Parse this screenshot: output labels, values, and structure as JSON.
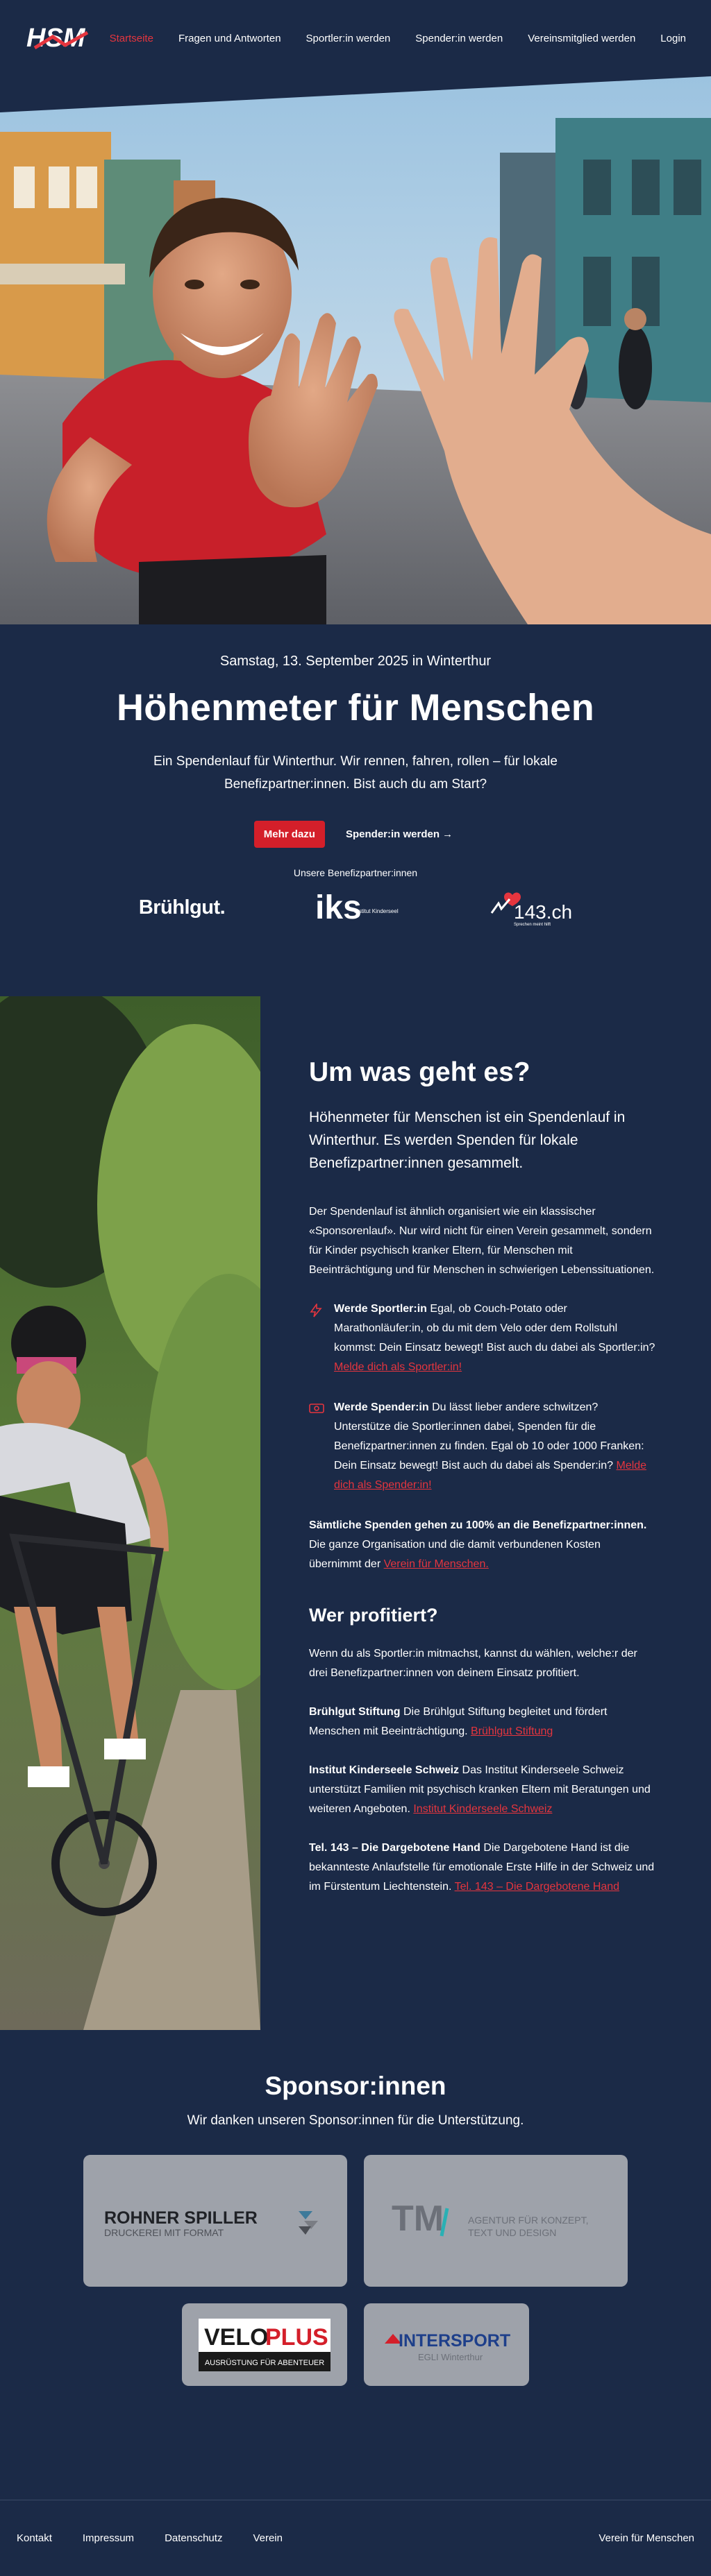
{
  "nav": {
    "logo_text": "HSM",
    "links": [
      {
        "label": "Startseite",
        "active": true
      },
      {
        "label": "Fragen und Antworten"
      },
      {
        "label": "Sportler:in werden"
      },
      {
        "label": "Spender:in werden"
      },
      {
        "label": "Vereinsmitglied werden"
      },
      {
        "label": "Login"
      }
    ]
  },
  "event": {
    "date": "Samstag, 13. September 2025 in Winterthur",
    "title": "Höhenmeter für Menschen",
    "desc": "Ein Spendenlauf für Winterthur. Wir rennen, fahren, rollen – für lokale Benefizpartner:innen. Bist auch du am Start?",
    "btn_more": "Mehr dazu",
    "btn_donor": "Spender:in werden →",
    "partners_title": "Unsere Benefizpartner:innen",
    "partners": [
      "Brühlgut.",
      "iks",
      "Institut Kinderseele Schweiz",
      "143.ch",
      "Sprechen meint hilft"
    ]
  },
  "about": {
    "title": "Um was geht es?",
    "lead": "Höhenmeter für Menschen ist ein Spendenlauf in Winterthur. Es werden Spenden für lokale Benefizpartner:innen gesammelt.",
    "p1": "Der Spendenlauf ist ähnlich organisiert wie ein klassischer «Sponsorenlauf». Nur wird nicht für einen Verein gesammelt, sondern für Kinder psychisch kranker Eltern, für Menschen mit Beeinträchtigung und für Menschen in schwierigen Lebenssituationen.",
    "feature1": {
      "title": "Werde Sportler:in",
      "text": " Egal, ob Couch-Potato oder Marathonläufer:in, ob du mit dem Velo oder dem Rollstuhl kommst: Dein Einsatz bewegt! Bist auch du dabei als Sportler:in? ",
      "link": "Melde dich als Sportler:in!"
    },
    "feature2": {
      "title": "Werde Spender:in",
      "text": " Du lässt lieber andere schwitzen? Unterstütze die Sportler:innen dabei, Spenden für die Benefizpartner:innen zu finden. Egal ob 10 oder 1000 Franken: Dein Einsatz bewegt! Bist auch du dabei als Spender:in? ",
      "link": "Melde dich als Spender:in!"
    },
    "all_donations_bold": "Sämtliche Spenden gehen zu 100% an die Benefizpartner:innen.",
    "all_donations_text": " Die ganze Organisation und die damit verbundenen Kosten übernimmt der ",
    "all_donations_link": "Verein für Menschen.",
    "who_title": "Wer profitiert?",
    "who_intro": "Wenn du als Sportler:in mitmachst, kannst du wählen, welche:r der drei Benefizpartner:innen von deinem Einsatz profitiert.",
    "b1_title": "Brühlgut Stiftung",
    "b1_text": " Die Brühlgut Stiftung begleitet und fördert Menschen mit Beeinträchtigung. ",
    "b1_link": "Brühlgut Stiftung",
    "b2_title": "Institut Kinderseele Schweiz",
    "b2_text": " Das Institut Kinderseele Schweiz unterstützt Familien mit psychisch kranken Eltern mit Beratungen und weiteren Angeboten. ",
    "b2_link": "Institut Kinderseele Schweiz",
    "b3_title": "Tel. 143 – Die Dargebotene Hand",
    "b3_text": " Die Dargebotene Hand ist die bekannteste Anlaufstelle für emotionale Erste Hilfe in der Schweiz und im Fürstentum Liechtenstein. ",
    "b3_link": "Tel. 143 – Die Dargebotene Hand"
  },
  "sponsors": {
    "title": "Sponsor:innen",
    "sub": "Wir danken unseren Sponsor:innen für die Unterstützung.",
    "rohner_name": "ROHNER SPILLER",
    "rohner_tag": "DRUCKEREI MIT FORMAT",
    "tm_name": "TM",
    "tm_tag1": "AGENTUR FÜR KONZEPT,",
    "tm_tag2": "TEXT UND DESIGN",
    "velo_name_a": "VELO",
    "velo_name_b": "PLUS",
    "velo_tag": "AUSRÜSTUNG FÜR ABENTEUER",
    "inter_name": "INTERSPORT",
    "inter_tag": "EGLI Winterthur"
  },
  "footer": {
    "links": [
      "Kontakt",
      "Impressum",
      "Datenschutz",
      "Verein"
    ],
    "right": "Verein für Menschen"
  },
  "colors": {
    "bg": "#1b2a47",
    "accent": "#e5353e",
    "button": "#d41f2a",
    "card": "#9ea2aa"
  }
}
